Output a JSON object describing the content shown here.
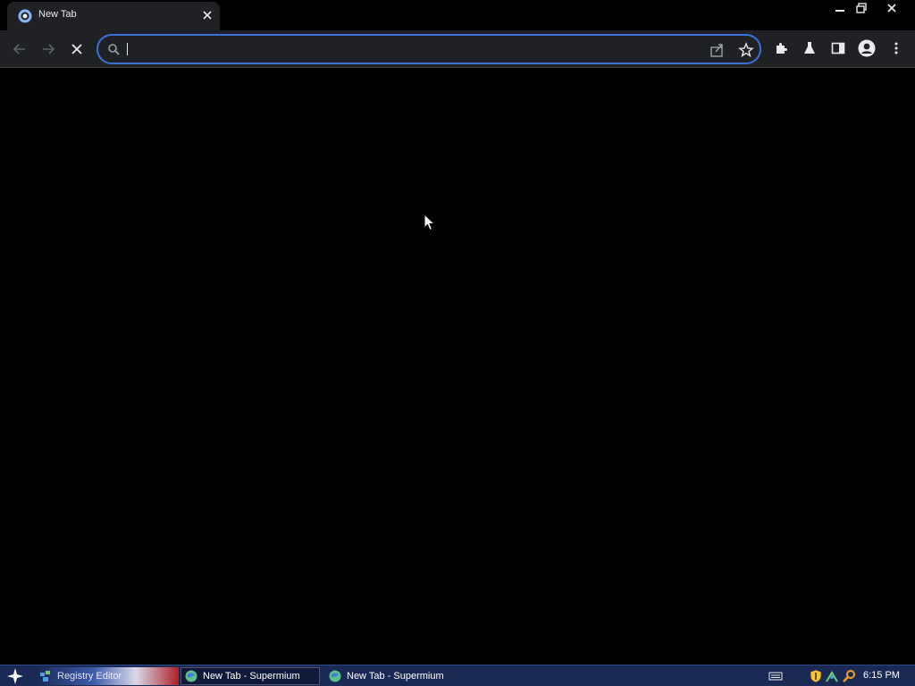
{
  "tab": {
    "title": "New Tab",
    "close_label": "✕"
  },
  "omnibox": {
    "value": "",
    "placeholder": ""
  },
  "taskbar": {
    "tasks": [
      {
        "label": "Registry Editor"
      },
      {
        "label": "New Tab - Supermium"
      },
      {
        "label": "New Tab - Supermium"
      }
    ],
    "clock": "6:15 PM"
  },
  "colors": {
    "accent": "#3b72d8",
    "toolbar_bg": "#202124",
    "page_bg": "#000000",
    "taskbar_bg": "#1a2a55"
  },
  "icons": {
    "tab_favicon": "browser-logo-icon",
    "back": "arrow-left-icon",
    "forward": "arrow-right-icon",
    "stop": "close-icon",
    "search": "search-icon",
    "share": "share-icon",
    "bookmark": "star-icon",
    "extensions": "puzzle-icon",
    "labs": "flask-icon",
    "side_panel": "side-panel-icon",
    "profile": "avatar-icon",
    "menu": "kebab-menu-icon"
  }
}
